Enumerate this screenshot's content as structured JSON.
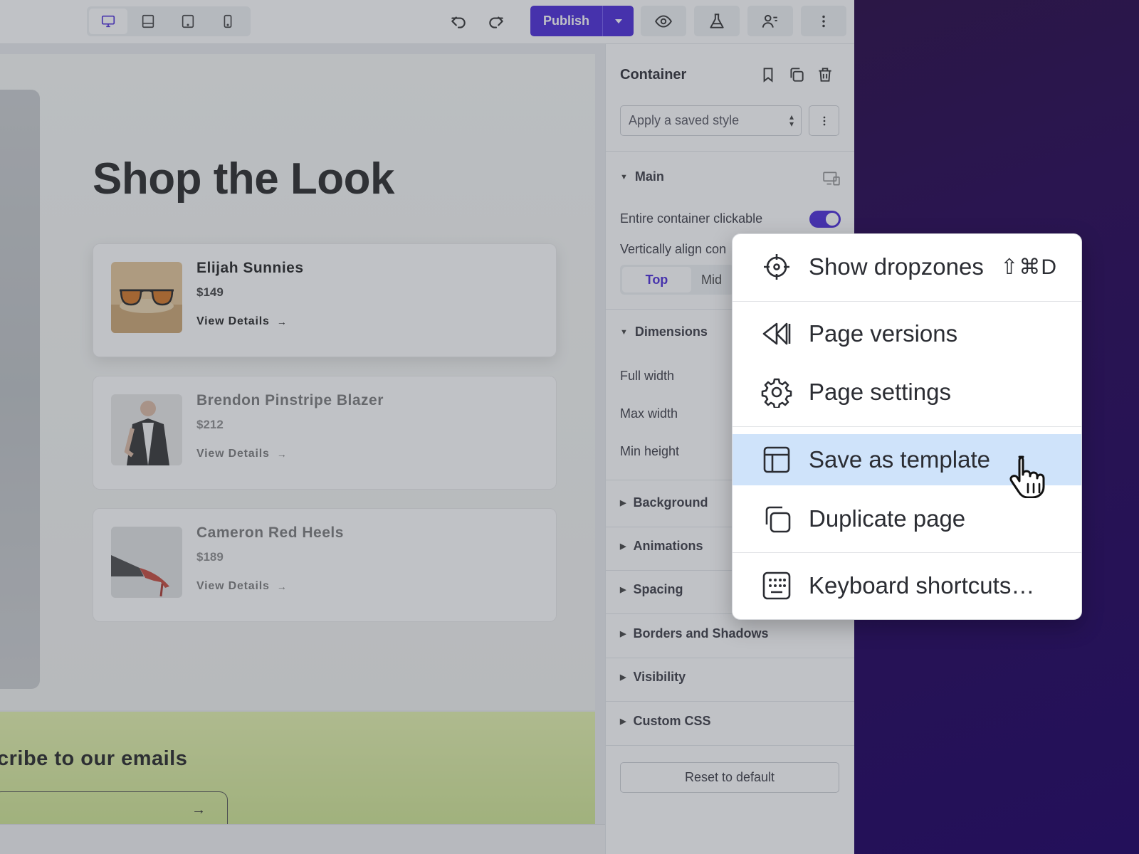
{
  "toolbar": {
    "devices": [
      "desktop-icon",
      "laptop-icon",
      "tablet-icon",
      "mobile-icon"
    ],
    "active_device": "desktop",
    "publish_label": "Publish"
  },
  "canvas": {
    "heading": "Shop the Look",
    "products": [
      {
        "name": "Elijah Sunnies",
        "price": "$149",
        "link": "View Details"
      },
      {
        "name": "Brendon Pinstripe Blazer",
        "price": "$212",
        "link": "View Details"
      },
      {
        "name": "Cameron Red Heels",
        "price": "$189",
        "link": "View Details"
      }
    ],
    "email_heading": "cribe to our emails",
    "email_submit_icon": "→"
  },
  "panel": {
    "title": "Container",
    "style_select_value": "Apply a saved style",
    "main_section": "Main",
    "entire_clickable_label": "Entire container clickable",
    "entire_clickable_on": true,
    "valign_label": "Vertically align con",
    "valign_options": [
      "Top",
      "Mid"
    ],
    "dimensions_section": "Dimensions",
    "full_width_label": "Full width",
    "max_width_label": "Max width",
    "min_height_label": "Min height",
    "sections": [
      "Background",
      "Animations",
      "Spacing",
      "Borders and Shadows",
      "Visibility",
      "Custom CSS"
    ],
    "reset_label": "Reset to default"
  },
  "menu": {
    "items": [
      {
        "label": "Show dropzones",
        "shortcut": "⇧⌘D",
        "icon": "crosshair-icon"
      },
      {
        "label": "Page versions",
        "icon": "rewind-icon"
      },
      {
        "label": "Page settings",
        "icon": "gear-icon"
      },
      {
        "label": "Save as template",
        "icon": "template-icon",
        "highlighted": true
      },
      {
        "label": "Duplicate page",
        "icon": "duplicate-icon"
      },
      {
        "label": "Keyboard shortcuts…",
        "icon": "keyboard-icon"
      }
    ]
  },
  "colors": {
    "accent": "#3b17d6",
    "menu_highlight": "#cfe3fa",
    "background_right": "#2a1550"
  }
}
